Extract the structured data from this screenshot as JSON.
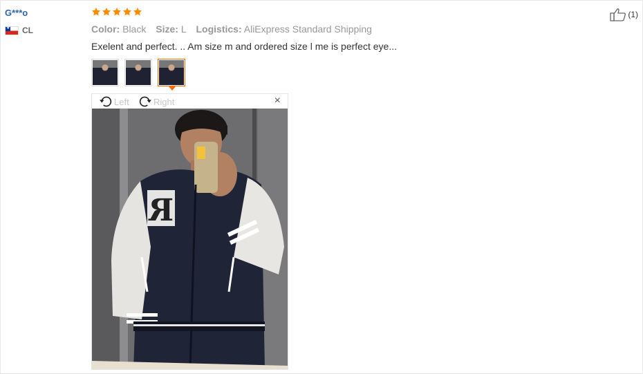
{
  "user": {
    "name": "G***o",
    "country_code": "CL"
  },
  "rating": {
    "stars": 5,
    "star_color": "#ff8a00"
  },
  "meta": {
    "color_label": "Color:",
    "color_value": "Black",
    "size_label": "Size:",
    "size_value": "L",
    "logistics_label": "Logistics:",
    "logistics_value": "AliExpress Standard Shipping"
  },
  "review_text": "Exelent and perfect. .. Am size m and ordered size l me is perfect eye...",
  "helpful": {
    "count_text": "(1)"
  },
  "viewer": {
    "left_label": "Left",
    "right_label": "Right",
    "close_label": "×"
  },
  "thumbnails_count": 3,
  "selected_thumbnail": 3
}
